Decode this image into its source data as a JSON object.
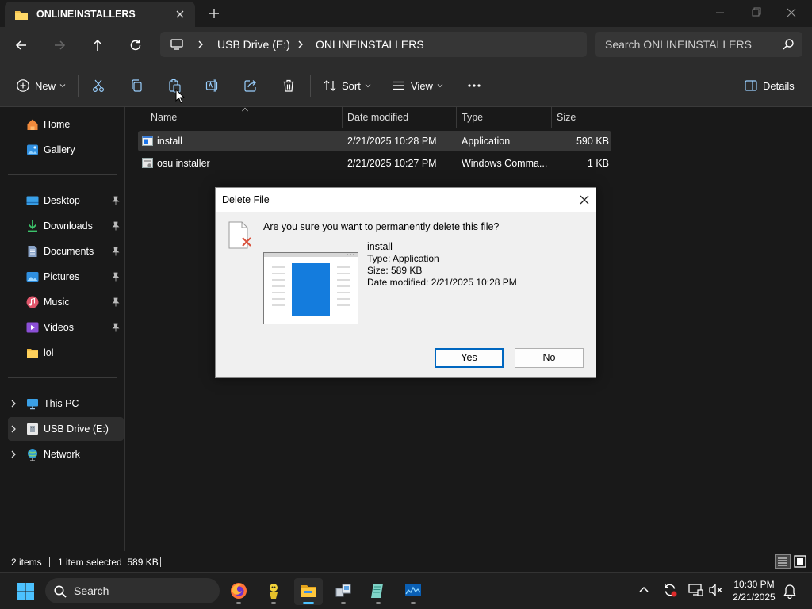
{
  "window": {
    "tab_title": "ONLINEINSTALLERS",
    "new_tab_icon": "plus-icon"
  },
  "address": {
    "segments": [
      "USB Drive (E:)",
      "ONLINEINSTALLERS"
    ],
    "search_placeholder": "Search ONLINEINSTALLERS"
  },
  "commandbar": {
    "new_label": "New",
    "sort_label": "Sort",
    "view_label": "View",
    "details_label": "Details",
    "icons": [
      "cut-icon",
      "copy-icon",
      "paste-icon",
      "rename-icon",
      "share-icon",
      "delete-icon",
      "more-icon"
    ]
  },
  "sidebar": {
    "quick": [
      {
        "label": "Home",
        "icon": "home-icon"
      },
      {
        "label": "Gallery",
        "icon": "gallery-icon"
      }
    ],
    "pinned": [
      {
        "label": "Desktop",
        "icon": "desktop-icon"
      },
      {
        "label": "Downloads",
        "icon": "downloads-icon"
      },
      {
        "label": "Documents",
        "icon": "documents-icon"
      },
      {
        "label": "Pictures",
        "icon": "pictures-icon"
      },
      {
        "label": "Music",
        "icon": "music-icon"
      },
      {
        "label": "Videos",
        "icon": "videos-icon"
      },
      {
        "label": "lol",
        "icon": "folder-icon"
      }
    ],
    "drives": [
      {
        "label": "This PC",
        "icon": "pc-icon"
      },
      {
        "label": "USB Drive (E:)",
        "icon": "usb-drive-icon",
        "selected": true
      },
      {
        "label": "Network",
        "icon": "network-icon"
      }
    ]
  },
  "filelist": {
    "columns": [
      "Name",
      "Date modified",
      "Type",
      "Size"
    ],
    "rows": [
      {
        "name": "install",
        "date": "2/21/2025 10:28 PM",
        "type": "Application",
        "size": "590 KB",
        "selected": true
      },
      {
        "name": "osu installer",
        "date": "2/21/2025 10:27 PM",
        "type": "Windows Comma...",
        "size": "1 KB",
        "selected": false
      }
    ]
  },
  "statusbar": {
    "count": "2 items",
    "selection": "1 item selected  589 KB"
  },
  "dialog": {
    "title": "Delete File",
    "question": "Are you sure you want to permanently delete this file?",
    "file_name": "install",
    "file_type": "Type: Application",
    "file_size": "Size: 589 KB",
    "file_date": "Date modified: 2/21/2025 10:28 PM",
    "yes_label": "Yes",
    "no_label": "No"
  },
  "taskbar": {
    "search_label": "Search",
    "time": "10:30 PM",
    "date": "2/21/2025",
    "accent": "#4cc2ff"
  }
}
